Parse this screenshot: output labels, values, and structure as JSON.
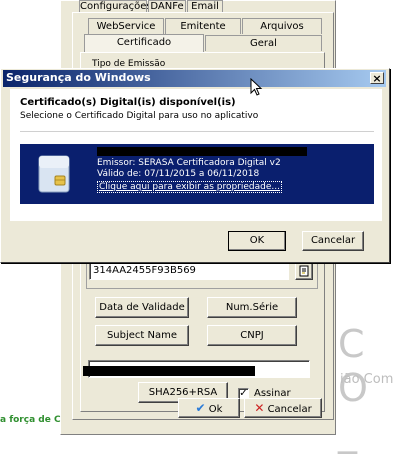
{
  "background_window": {
    "tabs_top": [
      "Configurações",
      "DANFe",
      "Email"
    ],
    "tabs_row2": [
      "WebService",
      "Emitente",
      "Arquivos"
    ],
    "tabs_row3": [
      "Certificado",
      "Geral"
    ],
    "tipo_emissao_label": "Tipo de Emissão",
    "serial_value": "314AA2455F93B569",
    "buttons": {
      "data_validade": "Data de Validade",
      "num_serie": "Num.Série",
      "subject_name": "Subject Name",
      "cnpj": "CNPJ",
      "sha": "SHA256+RSA",
      "ok": "Ok",
      "cancelar": "Cancelar"
    },
    "assinar_label": "Assinar",
    "assinar_checked": true
  },
  "background_text": {
    "left_bottom": "a força de C",
    "right_big": "C O _",
    "right_small": "ião Com"
  },
  "dialog": {
    "title": "Segurança do Windows",
    "close_glyph": "×",
    "heading": "Certificado(s) Digital(is) disponível(is)",
    "subheading": "Selecione o Certificado Digital para uso no aplicativo",
    "cert": {
      "emissor": "Emissor: SERASA Certificadora Digital v2",
      "validade": "Válido de: 07/11/2015 a 06/11/2018",
      "link": "Clique aqui para exibir as propriedade..."
    },
    "ok_label": "OK",
    "cancel_label": "Cancelar"
  },
  "colors": {
    "title_gradient_start": "#0a246a",
    "title_gradient_end": "#a6caf0",
    "cert_panel": "#0a1f6e",
    "bottom_text_green": "#2f8f2f",
    "ok_check": "#2a7bd8",
    "cancel_x": "#cc2222"
  }
}
